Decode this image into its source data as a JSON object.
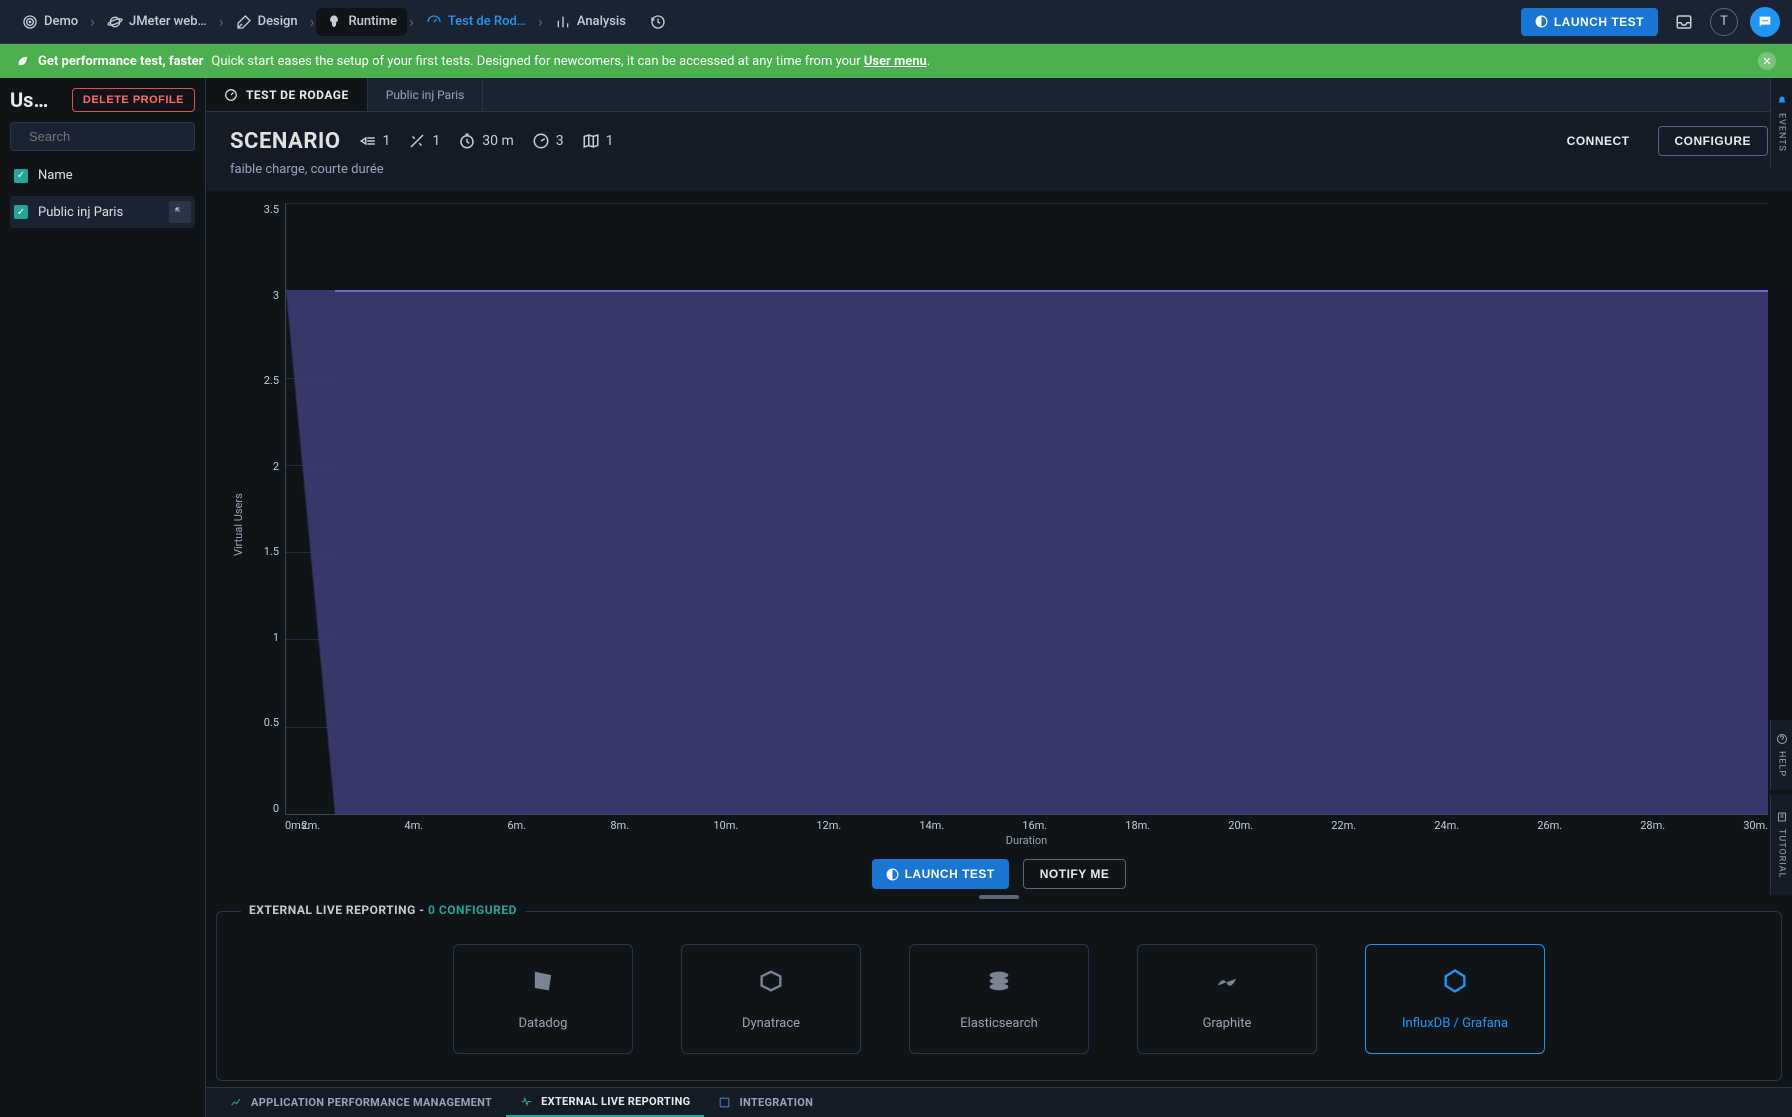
{
  "breadcrumb": [
    {
      "label": "Demo",
      "icon": "target"
    },
    {
      "label": "JMeter web…",
      "icon": "planet"
    },
    {
      "label": "Design",
      "icon": "design"
    },
    {
      "label": "Runtime",
      "icon": "rocket",
      "active": true
    },
    {
      "label": "Test de Rod…",
      "icon": "gauge",
      "highlighted": true
    },
    {
      "label": "Analysis",
      "icon": "bars"
    }
  ],
  "topbar": {
    "launch_label": "LAUNCH TEST",
    "avatar_letter": "T"
  },
  "banner": {
    "headline": "Get performance test, faster",
    "body_prefix": "Quick start eases the setup of your first tests. Designed for newcomers, it can be accessed at any time from your ",
    "link": "User menu",
    "body_suffix": "."
  },
  "sidebar": {
    "title": "Us…",
    "delete_label": "DELETE PROFILE",
    "search_placeholder": "Search",
    "items": [
      {
        "label": "Name",
        "checked": true
      },
      {
        "label": "Public inj Paris",
        "checked": true,
        "selected": true
      }
    ]
  },
  "tabs": [
    {
      "label": "TEST DE RODAGE",
      "active": true
    },
    {
      "label": "Public inj Paris"
    }
  ],
  "scenario": {
    "title": "SCENARIO",
    "metrics": {
      "groups": "1",
      "scripts": "1",
      "duration": "30 m",
      "vus": "3",
      "zones": "1"
    },
    "subtitle": "faible charge, courte durée",
    "connect": "CONNECT",
    "configure": "CONFIGURE"
  },
  "chart_data": {
    "type": "area",
    "title": "",
    "xlabel": "Duration",
    "ylabel": "Virtual Users",
    "ylim": [
      0,
      3.5
    ],
    "yticks": [
      "3.5",
      "3",
      "2.5",
      "2",
      "1.5",
      "1",
      "0.5",
      "0"
    ],
    "xticks": [
      "0ms.",
      "2m.",
      "4m.",
      "6m.",
      "8m.",
      "10m.",
      "12m.",
      "14m.",
      "16m.",
      "18m.",
      "20m.",
      "22m.",
      "24m.",
      "26m.",
      "28m.",
      "30m."
    ],
    "series": [
      {
        "name": "Virtual Users",
        "x_minutes": [
          0,
          1,
          30
        ],
        "y": [
          0,
          3,
          3
        ]
      }
    ]
  },
  "chart_actions": {
    "launch": "LAUNCH TEST",
    "notify": "NOTIFY ME"
  },
  "external": {
    "title_prefix": "EXTERNAL LIVE REPORTING - ",
    "count_label": "0 CONFIGURED",
    "cards": [
      {
        "label": "Datadog"
      },
      {
        "label": "Dynatrace"
      },
      {
        "label": "Elasticsearch"
      },
      {
        "label": "Graphite"
      },
      {
        "label": "InfluxDB / Grafana",
        "selected": true
      }
    ]
  },
  "bottom_tabs": [
    {
      "label": "APPLICATION PERFORMANCE MANAGEMENT"
    },
    {
      "label": "EXTERNAL LIVE REPORTING",
      "active": true
    },
    {
      "label": "INTEGRATION"
    }
  ],
  "rails": {
    "events": "EVENTS",
    "help": "HELP",
    "tutorial": "TUTORIAL"
  }
}
